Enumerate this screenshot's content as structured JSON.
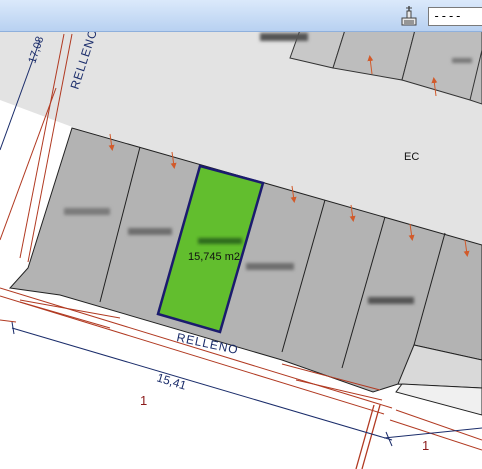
{
  "toolbar": {
    "layer_select_value": "----",
    "layer_icon": "layer-tool-icon"
  },
  "map": {
    "selected_parcel_area": "15,745 m2",
    "zone_label": "EC",
    "street_label_top": "RELLENO",
    "street_label_bottom": "RELLENO",
    "dimension_left": "17,08",
    "dimension_bottom": "15,41",
    "block_number_left": "1",
    "block_number_right": "1",
    "colors": {
      "selected_parcel_fill": "#62be2e",
      "selected_parcel_border": "#1b1b6e",
      "parcel_fill": "#b4b4b4",
      "street_fill": "#dedede",
      "boundary_line": "#b13a22",
      "block_number": "#8b1a1a"
    }
  }
}
